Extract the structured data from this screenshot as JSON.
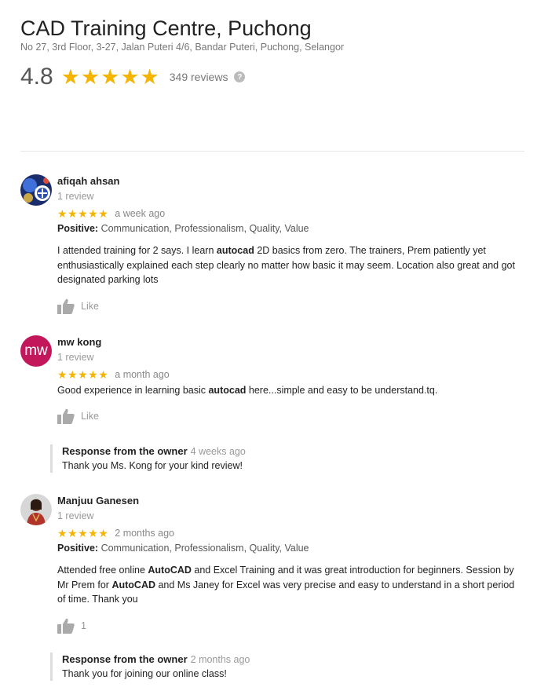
{
  "business": {
    "name": "CAD Training Centre, Puchong",
    "address": "No 27, 3rd Floor, 3-27, Jalan Puteri 4/6, Bandar Puteri, Puchong, Selangor",
    "rating": "4.8",
    "rating_stars": "★★★★★",
    "review_count": "349 reviews",
    "help_icon": "?"
  },
  "reviews": [
    {
      "name": "afiqah ahsan",
      "review_count": "1 review",
      "stars": "★★★★★",
      "time": "a week ago",
      "positive_label": "Positive:",
      "positive_text": " Communication, Professionalism, Quality, Value",
      "text_parts": [
        "I attended training for 2 says. I learn ",
        "autocad",
        " 2D basics from zero. The trainers, Prem patiently yet enthusiastically explained each step clearly no matter how basic it may seem. Location also great and got designated parking lots"
      ],
      "like_label": "Like"
    },
    {
      "name": "mw kong",
      "avatar_text": "mw",
      "review_count": "1 review",
      "stars": "★★★★★",
      "time": "a month ago",
      "text_parts": [
        "Good experience in learning basic ",
        "autocad",
        " here...simple and easy to be understand.tq."
      ],
      "like_label": "Like",
      "owner_response": {
        "heading": "Response from the owner",
        "time": "4 weeks ago",
        "text": "Thank you Ms. Kong for your kind review!"
      }
    },
    {
      "name": "Manjuu Ganesen",
      "review_count": "1 review",
      "stars": "★★★★★",
      "time": "2 months ago",
      "positive_label": "Positive:",
      "positive_text": " Communication, Professionalism, Quality, Value",
      "text_parts": [
        "Attended free online ",
        "AutoCAD",
        " and Excel Training and it was great introduction for beginners. Session by Mr Prem for ",
        "AutoCAD",
        " and Ms Janey for Excel was very precise and easy to understand in a short period of time. Thank you"
      ],
      "like_label": "1",
      "owner_response": {
        "heading": "Response from the owner",
        "time": "2 months ago",
        "text": "Thank you for joining our online class!"
      }
    }
  ],
  "colors": {
    "star": "#f5b400",
    "mw_avatar": "#c2185b"
  },
  "icons": {
    "thumb": "thumbs-up-icon",
    "help": "help-icon"
  }
}
